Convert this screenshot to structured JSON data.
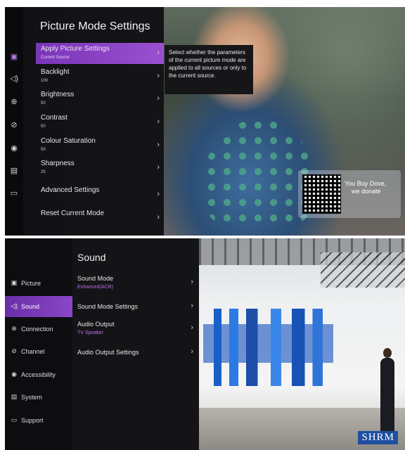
{
  "panel1": {
    "title": "Picture Mode Settings",
    "items": [
      {
        "label": "Apply Picture Settings",
        "value": "Current Source"
      },
      {
        "label": "Backlight",
        "value": "100"
      },
      {
        "label": "Brightness",
        "value": "50"
      },
      {
        "label": "Contrast",
        "value": "50"
      },
      {
        "label": "Colour Saturation",
        "value": "50"
      },
      {
        "label": "Sharpness",
        "value": "25"
      },
      {
        "label": "Advanced Settings",
        "value": ""
      },
      {
        "label": "Reset Current Mode",
        "value": ""
      }
    ],
    "tooltip": "Select whether the parameters of the current picture mode are applied to all sources or only to the current source.",
    "qr_text": {
      "line1": "You Buy Dove,",
      "line2": "we donate"
    },
    "accent_color": "#8b45c8"
  },
  "panel2": {
    "title": "Sound",
    "nav": [
      {
        "label": "Picture",
        "icon": "picture-icon"
      },
      {
        "label": "Sound",
        "icon": "speaker-icon"
      },
      {
        "label": "Connection",
        "icon": "globe-icon"
      },
      {
        "label": "Channel",
        "icon": "channel-icon"
      },
      {
        "label": "Accessibility",
        "icon": "accessibility-icon"
      },
      {
        "label": "System",
        "icon": "system-icon"
      },
      {
        "label": "Support",
        "icon": "support-icon"
      }
    ],
    "items": [
      {
        "label": "Sound Mode",
        "value": "Enhanced(ACR)"
      },
      {
        "label": "Sound Mode Settings",
        "value": ""
      },
      {
        "label": "Audio Output",
        "value": "TV Speaker"
      },
      {
        "label": "Audio Output Settings",
        "value": ""
      }
    ],
    "logo": "SHRM"
  }
}
